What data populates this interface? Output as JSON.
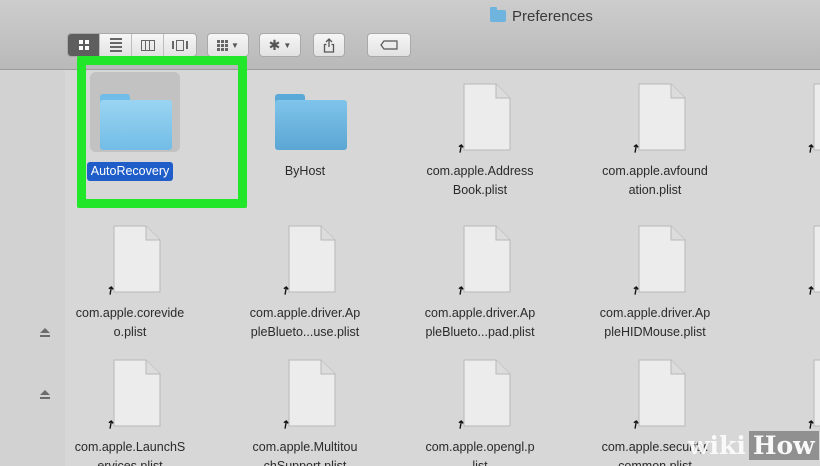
{
  "window": {
    "title": "Preferences"
  },
  "toolbar": {
    "view_modes": [
      "icon",
      "list",
      "columns",
      "cover-flow"
    ],
    "active_view": "icon"
  },
  "colors": {
    "selection_label": "#1f5ec9",
    "highlight_box": "#21e62a",
    "folder": "#5ba6d4"
  },
  "files": [
    {
      "kind": "folder",
      "name": "AutoRecovery",
      "selected": true
    },
    {
      "kind": "folder",
      "name": "ByHost"
    },
    {
      "kind": "alias",
      "name": "com.apple.Address\nBook.plist"
    },
    {
      "kind": "alias",
      "name": "com.apple.avfound\nation.plist"
    },
    {
      "kind": "alias",
      "name": "com.a"
    },
    {
      "kind": "alias",
      "name": "com.apple.corevide\no.plist"
    },
    {
      "kind": "alias",
      "name": "com.apple.driver.Ap\npleBlueto...use.plist"
    },
    {
      "kind": "alias",
      "name": "com.apple.driver.Ap\npleBlueto...pad.plist"
    },
    {
      "kind": "alias",
      "name": "com.apple.driver.Ap\npleHIDMouse.plist"
    },
    {
      "kind": "alias",
      "name": "com.a"
    },
    {
      "kind": "alias",
      "name": "com.apple.LaunchS\nervices.plist"
    },
    {
      "kind": "alias",
      "name": "com.apple.Multitou\nchSupport.plist"
    },
    {
      "kind": "alias",
      "name": "com.apple.opengl.p\nlist"
    },
    {
      "kind": "alias",
      "name": "com.apple.security.\ncommon.plist"
    },
    {
      "kind": "alias",
      "name": "com.a"
    }
  ],
  "watermark": {
    "wiki": "wiki",
    "how": "How"
  }
}
